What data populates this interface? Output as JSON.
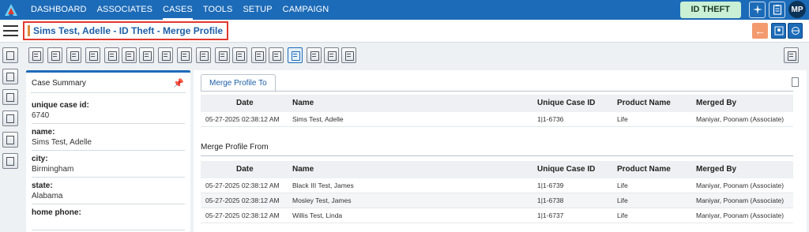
{
  "nav": {
    "items": [
      "DASHBOARD",
      "ASSOCIATES",
      "CASES",
      "TOOLS",
      "SETUP",
      "CAMPAIGN"
    ],
    "active": "CASES",
    "badge": "ID THEFT",
    "avatar": "MP"
  },
  "header": {
    "title": "Sims Test, Adelle - ID Theft - Merge Profile"
  },
  "summary": {
    "title": "Case Summary",
    "fields": [
      {
        "label": "unique case id:",
        "value": "6740"
      },
      {
        "label": "name:",
        "value": "Sims Test, Adelle"
      },
      {
        "label": "city:",
        "value": "Birmingham"
      },
      {
        "label": "state:",
        "value": "Alabama"
      },
      {
        "label": "home phone:",
        "value": ""
      }
    ]
  },
  "main": {
    "tab": "Merge Profile To",
    "section_from": "Merge Profile From",
    "columns": [
      "Date",
      "Name",
      "Unique Case ID",
      "Product Name",
      "Merged By"
    ],
    "to_rows": [
      [
        "05-27-2025 02:38:12 AM",
        "Sims Test, Adelle",
        "1|1-6736",
        "Life",
        "Maniyar, Poonam (Associate)"
      ]
    ],
    "from_rows": [
      [
        "05-27-2025 02:38:12 AM",
        "Black III Test, James",
        "1|1-6739",
        "Life",
        "Maniyar, Poonam (Associate)"
      ],
      [
        "05-27-2025 02:38:12 AM",
        "Mosley Test, James",
        "1|1-6738",
        "Life",
        "Maniyar, Poonam (Associate)"
      ],
      [
        "05-27-2025 02:38:12 AM",
        "Willis Test, Linda",
        "1|1-6737",
        "Life",
        "Maniyar, Poonam (Associate)"
      ]
    ]
  },
  "colors": {
    "nav_bg": "#1c6bb8",
    "title_text": "#1c5fa8",
    "title_border": "#e0392f",
    "badge_bg": "#c9f0d4",
    "back_button": "#f39a6e"
  }
}
